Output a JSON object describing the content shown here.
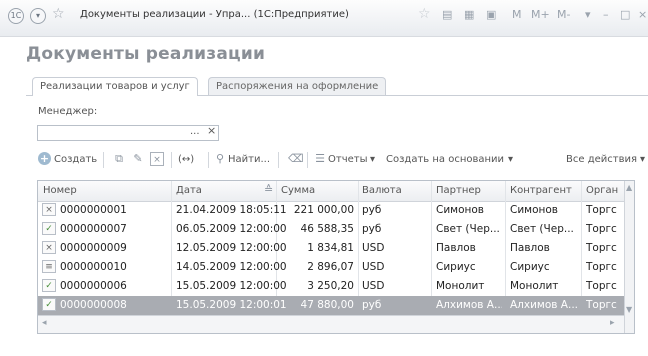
{
  "window": {
    "title": "Документы реализации - Упра... (1С:Предприятие)",
    "controls": [
      "M",
      "M+",
      "M-"
    ]
  },
  "page": {
    "title": "Документы реализации"
  },
  "tabs": [
    {
      "label": "Реализации товаров и услуг"
    },
    {
      "label": "Распоряжения на оформление"
    }
  ],
  "filter": {
    "manager_label": "Менеджер:",
    "manager_value": "",
    "select_glyph": "...",
    "clear_glyph": "×"
  },
  "toolbar": {
    "create": "Создать",
    "find": "Найти...",
    "reports": "Отчеты",
    "create_based": "Создать на основании",
    "all_actions": "Все действия",
    "arrows": "(↔)"
  },
  "table": {
    "columns": [
      "Номер",
      "Дата",
      "Сумма",
      "Валюта",
      "Партнер",
      "Контрагент",
      "Орган"
    ],
    "rows": [
      {
        "number": "0000000001",
        "date": "21.04.2009 18:05:11",
        "sum": "221 000,00",
        "currency": "руб",
        "partner": "Симонов",
        "counterparty": "Симонов",
        "org": "Торгс"
      },
      {
        "number": "0000000007",
        "date": "06.05.2009 12:00:00",
        "sum": "46 588,35",
        "currency": "руб",
        "partner": "Свет (Чер...",
        "counterparty": "Свет (Чер...",
        "org": "Торгс"
      },
      {
        "number": "0000000009",
        "date": "12.05.2009 12:00:00",
        "sum": "1 834,81",
        "currency": "USD",
        "partner": "Павлов",
        "counterparty": "Павлов",
        "org": "Торгс"
      },
      {
        "number": "0000000010",
        "date": "14.05.2009 12:00:00",
        "sum": "2 896,07",
        "currency": "USD",
        "partner": "Сириус",
        "counterparty": "Сириус",
        "org": "Торгс"
      },
      {
        "number": "0000000006",
        "date": "15.05.2009 12:00:00",
        "sum": "3 250,20",
        "currency": "USD",
        "partner": "Монолит",
        "counterparty": "Монолит",
        "org": "Торгс"
      },
      {
        "number": "0000000008",
        "date": "15.05.2009 12:00:01",
        "sum": "47 880,00",
        "currency": "руб",
        "partner": "Алхимов А...",
        "counterparty": "Алхимов А...",
        "org": "Торгс"
      }
    ]
  }
}
